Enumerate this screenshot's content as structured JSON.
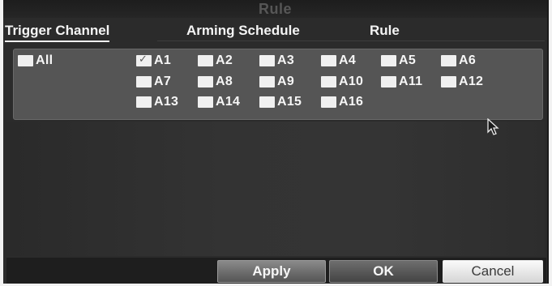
{
  "dialog": {
    "title": "Rule"
  },
  "tabs": [
    {
      "label": "Trigger Channel",
      "active": true
    },
    {
      "label": "Arming Schedule",
      "active": false
    },
    {
      "label": "Rule",
      "active": false
    }
  ],
  "trigger_channel": {
    "all": {
      "label": "All",
      "checked": false
    },
    "channels": [
      {
        "label": "A1",
        "checked": true
      },
      {
        "label": "A2",
        "checked": false
      },
      {
        "label": "A3",
        "checked": false
      },
      {
        "label": "A4",
        "checked": false
      },
      {
        "label": "A5",
        "checked": false
      },
      {
        "label": "A6",
        "checked": false
      },
      {
        "label": "A7",
        "checked": false
      },
      {
        "label": "A8",
        "checked": false
      },
      {
        "label": "A9",
        "checked": false
      },
      {
        "label": "A10",
        "checked": false
      },
      {
        "label": "A11",
        "checked": false
      },
      {
        "label": "A12",
        "checked": false
      },
      {
        "label": "A13",
        "checked": false
      },
      {
        "label": "A14",
        "checked": false
      },
      {
        "label": "A15",
        "checked": false
      },
      {
        "label": "A16",
        "checked": false
      }
    ]
  },
  "buttons": {
    "apply": "Apply",
    "ok": "OK",
    "cancel": "Cancel"
  },
  "colors": {
    "background": "#2b2b2b",
    "panel": "#555555",
    "text": "#f6f6f6",
    "checkbox": "#f0f0f0"
  },
  "icons": {
    "checkmark": "check-icon",
    "cursor": "mouse-pointer-icon"
  }
}
